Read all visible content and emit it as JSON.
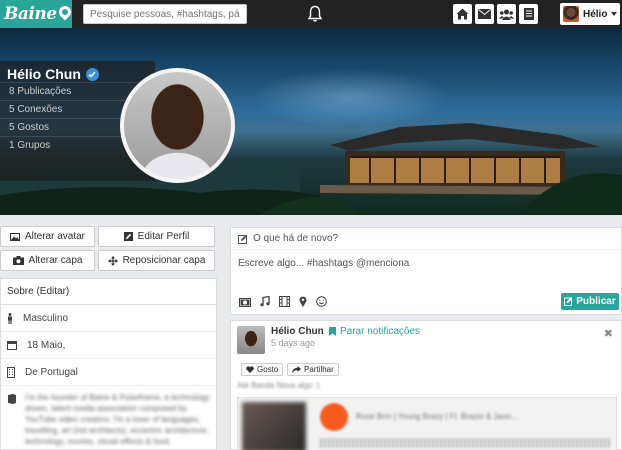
{
  "app": {
    "logo_text": "Baine"
  },
  "topbar": {
    "search_placeholder": "Pesquise pessoas, #hashtags, págin...",
    "icons": [
      "home-icon",
      "mail-icon",
      "users-icon",
      "document-icon"
    ],
    "user_name": "Hélio"
  },
  "profile": {
    "name": "Hélio Chun",
    "stats": [
      "8 Publicações",
      "5 Conexões",
      "5 Gostos",
      "1 Grupos"
    ]
  },
  "actions": {
    "change_avatar": "Alterar avatar",
    "edit_profile": "Editar Perfil",
    "change_cover": "Alterar capa",
    "reposition_cover": "Reposicionar capa"
  },
  "about": {
    "header": "Sobre (Editar)",
    "gender": "Masculino",
    "birthday": "18 Maio,",
    "origin": "De Portugal",
    "bio": "I'm the founder of Baine & Pulseframe, a technology driven, latent media association composed by YouTube video creators. I'm a lover of languages, travelling, art (not architects), eccentric architecture, technology, movies, visual effects & food."
  },
  "composer": {
    "prompt": "O que há de novo?",
    "placeholder": "Escreve algo... #hashtags @menciona",
    "publish_label": "Publicar"
  },
  "post": {
    "author": "Hélio Chun",
    "separator": "·",
    "follow_label": "Parar notificações",
    "time": "5 days ago",
    "like_label": "Gosto",
    "share_label": "Partilhar",
    "text": "Até Banda Nova algo :)",
    "embed_title": "Rose Brm | Young Brazy | Ft. Brazio & Jaoo..."
  },
  "colors": {
    "accent": "#2aa59a",
    "topbar": "#222222",
    "verified": "#3b8fd9"
  }
}
